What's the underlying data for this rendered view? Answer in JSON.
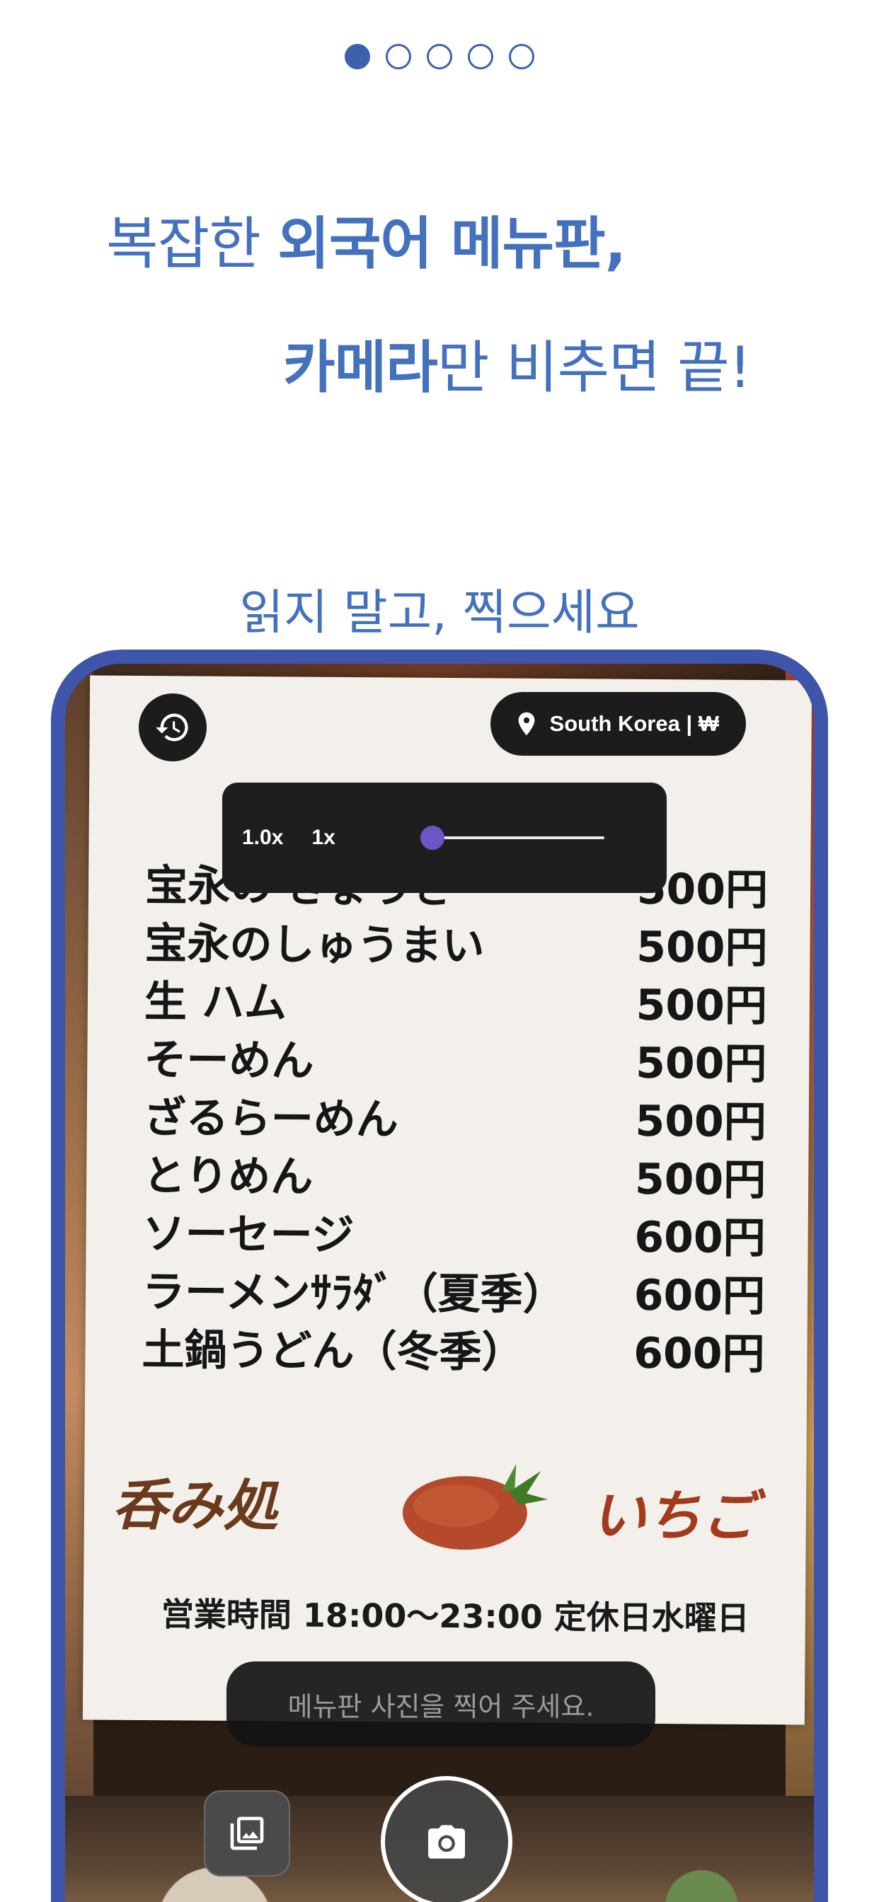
{
  "pager": {
    "total": 5,
    "active_index": 0
  },
  "headline": {
    "line1_regular": "복잡한 ",
    "line1_bold": "외국어 메뉴판,",
    "line2_bold": "카메라",
    "line2_regular": "만 비추면 끝!"
  },
  "subheadline": "읽지 말고, 찍으세요",
  "camera": {
    "history_icon": "history-icon",
    "location": {
      "icon": "location-pin-icon",
      "label": "South Korea | ₩"
    },
    "zoom": {
      "current": "1.0x",
      "base": "1x",
      "level": 0.0
    },
    "hint": "메뉴판 사진을 찍어 주세요.",
    "gallery_icon": "gallery-icon",
    "shutter_icon": "camera-icon"
  },
  "menu_photo": {
    "items": [
      {
        "name": "宝永の ぎょうざ",
        "price": "500円"
      },
      {
        "name": "宝永のしゅうまい",
        "price": "500円"
      },
      {
        "name": "生 ハム",
        "price": "500円"
      },
      {
        "name": "そーめん",
        "price": "500円"
      },
      {
        "name": "ざるらーめん",
        "price": "500円"
      },
      {
        "name": "とりめん",
        "price": "500円"
      },
      {
        "name": "ソーセージ",
        "price": "600円"
      },
      {
        "name": "ラーメンｻﾗﾀﾞ（夏季）",
        "price": "600円"
      },
      {
        "name": "土鍋うどん（冬季）",
        "price": "600円"
      }
    ],
    "shop_left": "呑み処",
    "shop_right": "いちご",
    "hours": "営業時間 18:00〜23:00 定休日水曜日"
  },
  "colors": {
    "accent": "#4371bd",
    "frame": "#3f55a9",
    "slider_knob": "#6e55c6"
  }
}
